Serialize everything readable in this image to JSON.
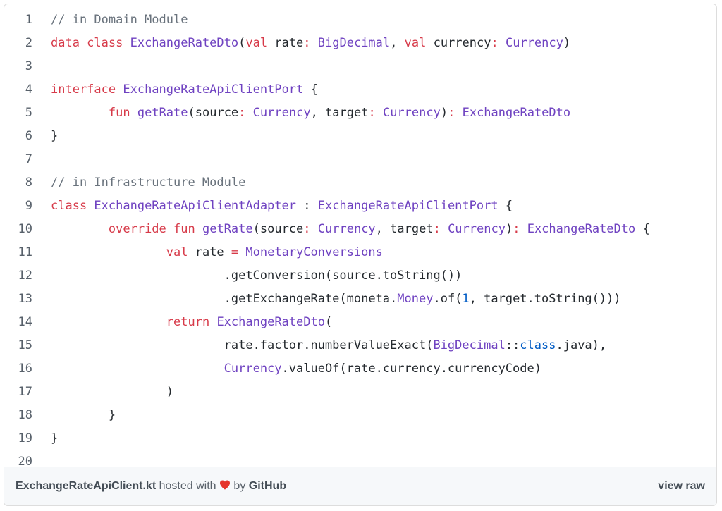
{
  "colors": {
    "keyword": "#d73a49",
    "type": "#6f42c1",
    "plain": "#24292e",
    "comment": "#6a737d",
    "number": "#005cc5",
    "line_number": "#57606a"
  },
  "lines": [
    {
      "n": "1",
      "tokens": [
        {
          "t": "// in Domain Module",
          "c": "comment"
        }
      ]
    },
    {
      "n": "2",
      "tokens": [
        {
          "t": "data class ",
          "c": "keyword"
        },
        {
          "t": "ExchangeRateDto",
          "c": "type"
        },
        {
          "t": "(",
          "c": "plain"
        },
        {
          "t": "val",
          "c": "keyword"
        },
        {
          "t": " rate",
          "c": "plain"
        },
        {
          "t": ":",
          "c": "keyword"
        },
        {
          "t": " ",
          "c": "plain"
        },
        {
          "t": "BigDecimal",
          "c": "type"
        },
        {
          "t": ", ",
          "c": "plain"
        },
        {
          "t": "val",
          "c": "keyword"
        },
        {
          "t": " currency",
          "c": "plain"
        },
        {
          "t": ":",
          "c": "keyword"
        },
        {
          "t": " ",
          "c": "plain"
        },
        {
          "t": "Currency",
          "c": "type"
        },
        {
          "t": ")",
          "c": "plain"
        }
      ]
    },
    {
      "n": "3",
      "tokens": []
    },
    {
      "n": "4",
      "tokens": [
        {
          "t": "interface ",
          "c": "keyword"
        },
        {
          "t": "ExchangeRateApiClientPort",
          "c": "type"
        },
        {
          "t": " {",
          "c": "plain"
        }
      ]
    },
    {
      "n": "5",
      "tokens": [
        {
          "t": "        ",
          "c": "plain"
        },
        {
          "t": "fun",
          "c": "keyword"
        },
        {
          "t": " ",
          "c": "plain"
        },
        {
          "t": "getRate",
          "c": "type"
        },
        {
          "t": "(source",
          "c": "plain"
        },
        {
          "t": ":",
          "c": "keyword"
        },
        {
          "t": " ",
          "c": "plain"
        },
        {
          "t": "Currency",
          "c": "type"
        },
        {
          "t": ", target",
          "c": "plain"
        },
        {
          "t": ":",
          "c": "keyword"
        },
        {
          "t": " ",
          "c": "plain"
        },
        {
          "t": "Currency",
          "c": "type"
        },
        {
          "t": ")",
          "c": "plain"
        },
        {
          "t": ":",
          "c": "keyword"
        },
        {
          "t": " ",
          "c": "plain"
        },
        {
          "t": "ExchangeRateDto",
          "c": "type"
        }
      ]
    },
    {
      "n": "6",
      "tokens": [
        {
          "t": "}",
          "c": "plain"
        }
      ]
    },
    {
      "n": "7",
      "tokens": []
    },
    {
      "n": "8",
      "tokens": [
        {
          "t": "// in Infrastructure Module",
          "c": "comment"
        }
      ]
    },
    {
      "n": "9",
      "tokens": [
        {
          "t": "class ",
          "c": "keyword"
        },
        {
          "t": "ExchangeRateApiClientAdapter",
          "c": "type"
        },
        {
          "t": " : ",
          "c": "plain"
        },
        {
          "t": "ExchangeRateApiClientPort",
          "c": "type"
        },
        {
          "t": " {",
          "c": "plain"
        }
      ]
    },
    {
      "n": "10",
      "tokens": [
        {
          "t": "        ",
          "c": "plain"
        },
        {
          "t": "override fun",
          "c": "keyword"
        },
        {
          "t": " ",
          "c": "plain"
        },
        {
          "t": "getRate",
          "c": "type"
        },
        {
          "t": "(source",
          "c": "plain"
        },
        {
          "t": ":",
          "c": "keyword"
        },
        {
          "t": " ",
          "c": "plain"
        },
        {
          "t": "Currency",
          "c": "type"
        },
        {
          "t": ", target",
          "c": "plain"
        },
        {
          "t": ":",
          "c": "keyword"
        },
        {
          "t": " ",
          "c": "plain"
        },
        {
          "t": "Currency",
          "c": "type"
        },
        {
          "t": ")",
          "c": "plain"
        },
        {
          "t": ":",
          "c": "keyword"
        },
        {
          "t": " ",
          "c": "plain"
        },
        {
          "t": "ExchangeRateDto",
          "c": "type"
        },
        {
          "t": " {",
          "c": "plain"
        }
      ]
    },
    {
      "n": "11",
      "tokens": [
        {
          "t": "                ",
          "c": "plain"
        },
        {
          "t": "val",
          "c": "keyword"
        },
        {
          "t": " rate ",
          "c": "plain"
        },
        {
          "t": "=",
          "c": "keyword"
        },
        {
          "t": " ",
          "c": "plain"
        },
        {
          "t": "MonetaryConversions",
          "c": "type"
        }
      ]
    },
    {
      "n": "12",
      "tokens": [
        {
          "t": "                        .getConversion(source.toString())",
          "c": "plain"
        }
      ]
    },
    {
      "n": "13",
      "tokens": [
        {
          "t": "                        .getExchangeRate(moneta.",
          "c": "plain"
        },
        {
          "t": "Money",
          "c": "type"
        },
        {
          "t": ".of(",
          "c": "plain"
        },
        {
          "t": "1",
          "c": "number"
        },
        {
          "t": ", target.toString()))",
          "c": "plain"
        }
      ]
    },
    {
      "n": "14",
      "tokens": [
        {
          "t": "                ",
          "c": "plain"
        },
        {
          "t": "return",
          "c": "keyword"
        },
        {
          "t": " ",
          "c": "plain"
        },
        {
          "t": "ExchangeRateDto",
          "c": "type"
        },
        {
          "t": "(",
          "c": "plain"
        }
      ]
    },
    {
      "n": "15",
      "tokens": [
        {
          "t": "                        rate.factor.numberValueExact(",
          "c": "plain"
        },
        {
          "t": "BigDecimal",
          "c": "type"
        },
        {
          "t": "::",
          "c": "plain"
        },
        {
          "t": "class",
          "c": "number"
        },
        {
          "t": ".java),",
          "c": "plain"
        }
      ]
    },
    {
      "n": "16",
      "tokens": [
        {
          "t": "                        ",
          "c": "plain"
        },
        {
          "t": "Currency",
          "c": "type"
        },
        {
          "t": ".valueOf(rate.currency.currencyCode)",
          "c": "plain"
        }
      ]
    },
    {
      "n": "17",
      "tokens": [
        {
          "t": "                )",
          "c": "plain"
        }
      ]
    },
    {
      "n": "18",
      "tokens": [
        {
          "t": "        }",
          "c": "plain"
        }
      ]
    },
    {
      "n": "19",
      "tokens": [
        {
          "t": "}",
          "c": "plain"
        }
      ]
    },
    {
      "n": "20",
      "tokens": []
    }
  ],
  "footer": {
    "filename": "ExchangeRateApiClient.kt",
    "hosted_with": " hosted with ",
    "heart_icon": "heart-icon",
    "by": " by ",
    "host": "GitHub",
    "view_raw": "view raw",
    "heart_color": "#e5332a"
  }
}
